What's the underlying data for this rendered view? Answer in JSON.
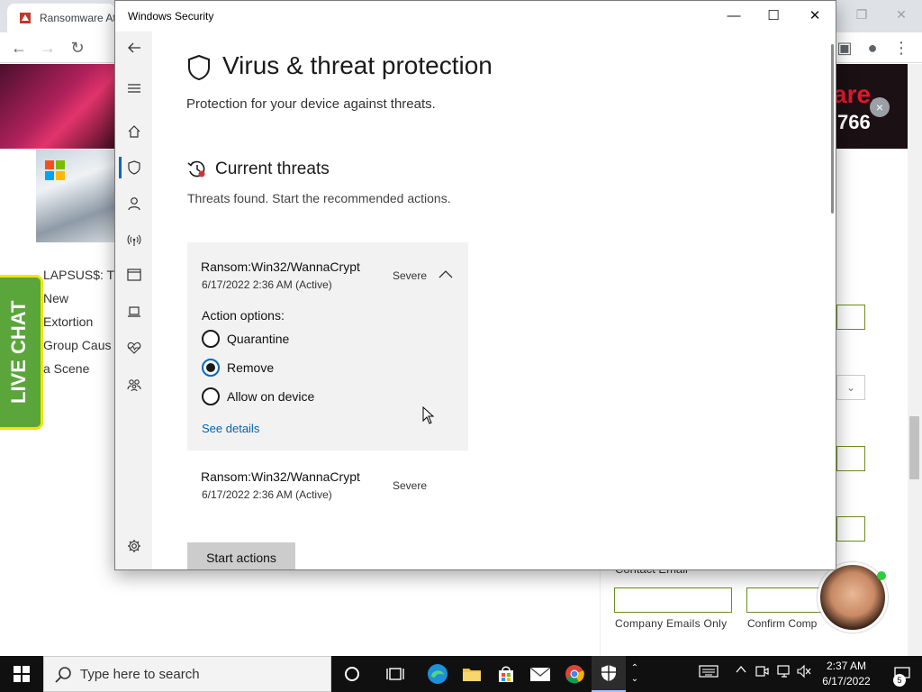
{
  "browser": {
    "tab_title": "Ransomware At",
    "banner_text_1": "are.",
    "banner_text_2": "766",
    "banner_close": "×",
    "article_text": "LAPSUS$: T New Extortion Group Caus a Scene",
    "live_chat": "LIVE CHAT",
    "contact_email_label": "Contact Email",
    "company_emails_only": "Company Emails Only",
    "confirm_company": "Confirm Comp",
    "select_chevron": "⌄"
  },
  "security_window": {
    "title": "Windows Security",
    "minimize": "—",
    "maximize": "☐",
    "close": "✕",
    "page_title": "Virus & threat protection",
    "page_subtitle": "Protection for your device against threats.",
    "section_title": "Current threats",
    "section_subtitle": "Threats found. Start the recommended actions.",
    "threats": [
      {
        "name": "Ransom:Win32/WannaCrypt",
        "date": "6/17/2022 2:36 AM (Active)",
        "severity": "Severe",
        "expanded": true
      },
      {
        "name": "Ransom:Win32/WannaCrypt",
        "date": "6/17/2022 2:36 AM (Active)",
        "severity": "Severe",
        "expanded": false
      }
    ],
    "action_options_label": "Action options:",
    "options": [
      {
        "label": "Quarantine",
        "selected": false
      },
      {
        "label": "Remove",
        "selected": true
      },
      {
        "label": "Allow on device",
        "selected": false
      }
    ],
    "see_details": "See details",
    "start_actions": "Start actions",
    "nav_icons": [
      "back-arrow-icon",
      "hamburger-menu-icon",
      "home-icon",
      "shield-icon",
      "person-icon",
      "wireless-icon",
      "app-browser-icon",
      "laptop-icon",
      "health-heart-icon",
      "family-icon",
      "settings-gear-icon"
    ]
  },
  "taskbar": {
    "search_placeholder": "Type here to search",
    "time": "2:37 AM",
    "date": "6/17/2022",
    "notification_count": "5"
  },
  "colors": {
    "accent": "#0067c0",
    "link": "#0063b1",
    "card_bg": "#f2f2f2",
    "taskbar": "#101010",
    "live_chat_green": "#5aa63a",
    "live_chat_border": "#f2e500",
    "banner_red": "#e2172a"
  }
}
